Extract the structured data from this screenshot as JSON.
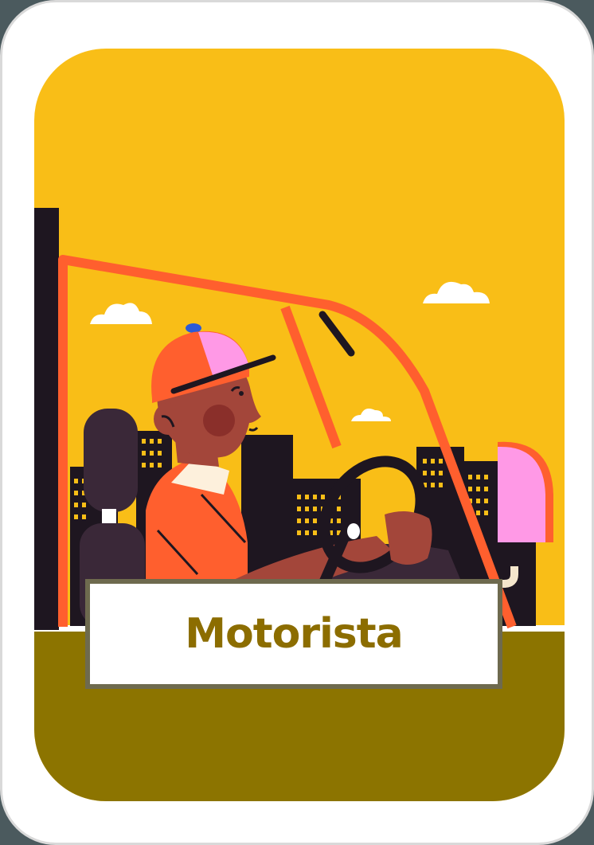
{
  "card": {
    "title": "Motorista"
  },
  "colors": {
    "background_sky": "#f9be17",
    "ground": "#8c7400",
    "frame": "#ff5f2e",
    "label_text": "#8c6d00",
    "card_border": "#ffffff"
  },
  "icons": [
    "driver-illustration",
    "car-frame",
    "city-skyline",
    "cloud-icon",
    "steering-wheel-icon",
    "mirror-icon"
  ]
}
